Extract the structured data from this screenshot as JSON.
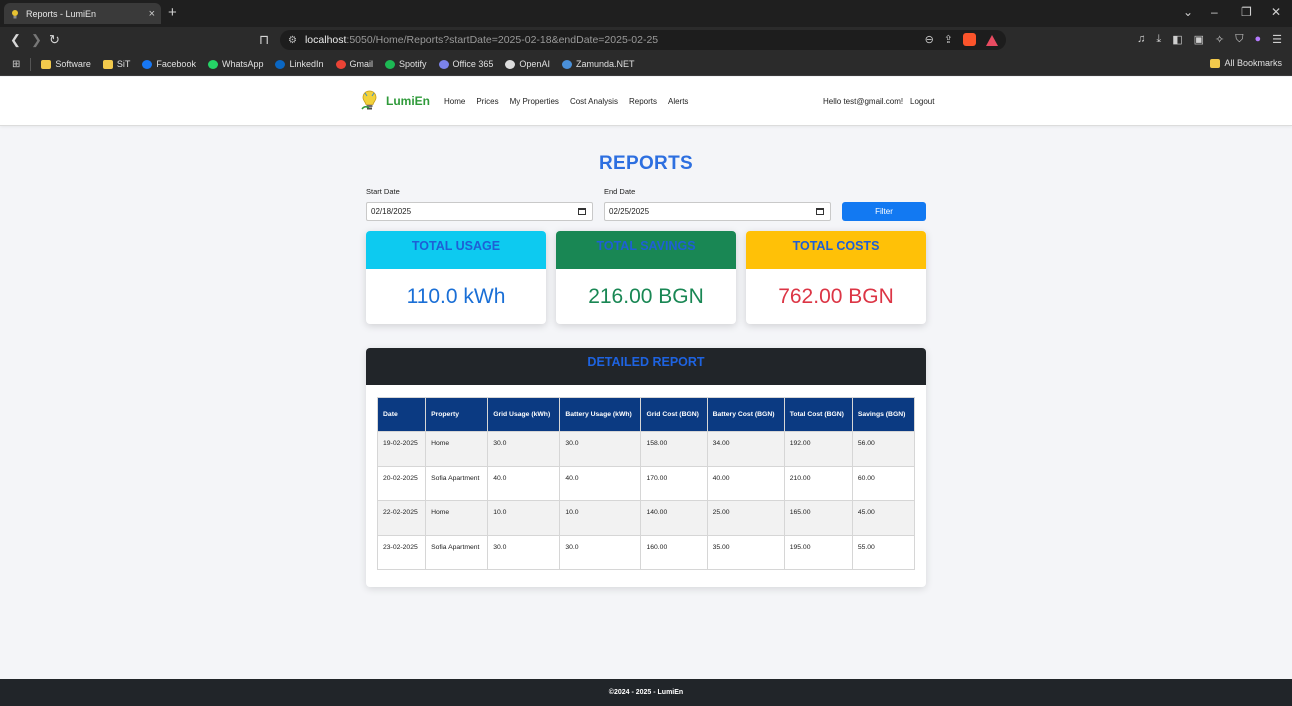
{
  "browser": {
    "tab_title": "Reports - LumiEn",
    "tab_close": "×",
    "new_tab": "+",
    "url_host": "localhost",
    "url_rest": ":5050/Home/Reports?startDate=2025-02-18&endDate=2025-02-25",
    "bookmarks": [
      {
        "label": "Software",
        "icon": "folder-icon",
        "color": "#f2c94c"
      },
      {
        "label": "SiT",
        "icon": "folder-icon",
        "color": "#f2c94c"
      },
      {
        "label": "Facebook",
        "icon": "facebook-icon",
        "color": "#1877f2"
      },
      {
        "label": "WhatsApp",
        "icon": "whatsapp-icon",
        "color": "#25d366"
      },
      {
        "label": "LinkedIn",
        "icon": "linkedin-icon",
        "color": "#0a66c2"
      },
      {
        "label": "Gmail",
        "icon": "gmail-icon",
        "color": "#ea4335"
      },
      {
        "label": "Spotify",
        "icon": "spotify-icon",
        "color": "#1db954"
      },
      {
        "label": "Office 365",
        "icon": "office-icon",
        "color": "#7b83eb"
      },
      {
        "label": "OpenAI",
        "icon": "openai-icon",
        "color": "#dddddd"
      },
      {
        "label": "Zamunda.NET",
        "icon": "zamunda-icon",
        "color": "#4a90d9"
      }
    ],
    "all_bookmarks": "All Bookmarks"
  },
  "nav": {
    "brand": "LumiEn",
    "links": [
      "Home",
      "Prices",
      "My Properties",
      "Cost Analysis",
      "Reports",
      "Alerts"
    ],
    "greeting": "Hello test@gmail.com!",
    "logout": "Logout"
  },
  "page": {
    "title": "REPORTS",
    "start_label": "Start Date",
    "start_value": "02/18/2025",
    "end_label": "End Date",
    "end_value": "02/25/2025",
    "filter_button": "Filter"
  },
  "cards": [
    {
      "title": "TOTAL USAGE",
      "value": "110.0 kWh",
      "header_color": "#0dcaf0",
      "value_color": "#1a6fd6"
    },
    {
      "title": "TOTAL SAVINGS",
      "value": "216.00 BGN",
      "header_color": "#198754",
      "value_color": "#198754"
    },
    {
      "title": "TOTAL COSTS",
      "value": "762.00 BGN",
      "header_color": "#ffc107",
      "value_color": "#dc3545"
    }
  ],
  "report": {
    "title": "DETAILED REPORT",
    "columns": [
      "Date",
      "Property",
      "Grid Usage (kWh)",
      "Battery Usage (kWh)",
      "Grid Cost (BGN)",
      "Battery Cost (BGN)",
      "Total Cost (BGN)",
      "Savings (BGN)"
    ],
    "rows": [
      [
        "19-02-2025",
        "Home",
        "30.0",
        "30.0",
        "158.00",
        "34.00",
        "192.00",
        "56.00"
      ],
      [
        "20-02-2025",
        "Sofia Apartment",
        "40.0",
        "40.0",
        "170.00",
        "40.00",
        "210.00",
        "60.00"
      ],
      [
        "22-02-2025",
        "Home",
        "10.0",
        "10.0",
        "140.00",
        "25.00",
        "165.00",
        "45.00"
      ],
      [
        "23-02-2025",
        "Sofia Apartment",
        "30.0",
        "30.0",
        "160.00",
        "35.00",
        "195.00",
        "55.00"
      ]
    ]
  },
  "footer": {
    "text": "©2024 - 2025 - LumiEn"
  }
}
